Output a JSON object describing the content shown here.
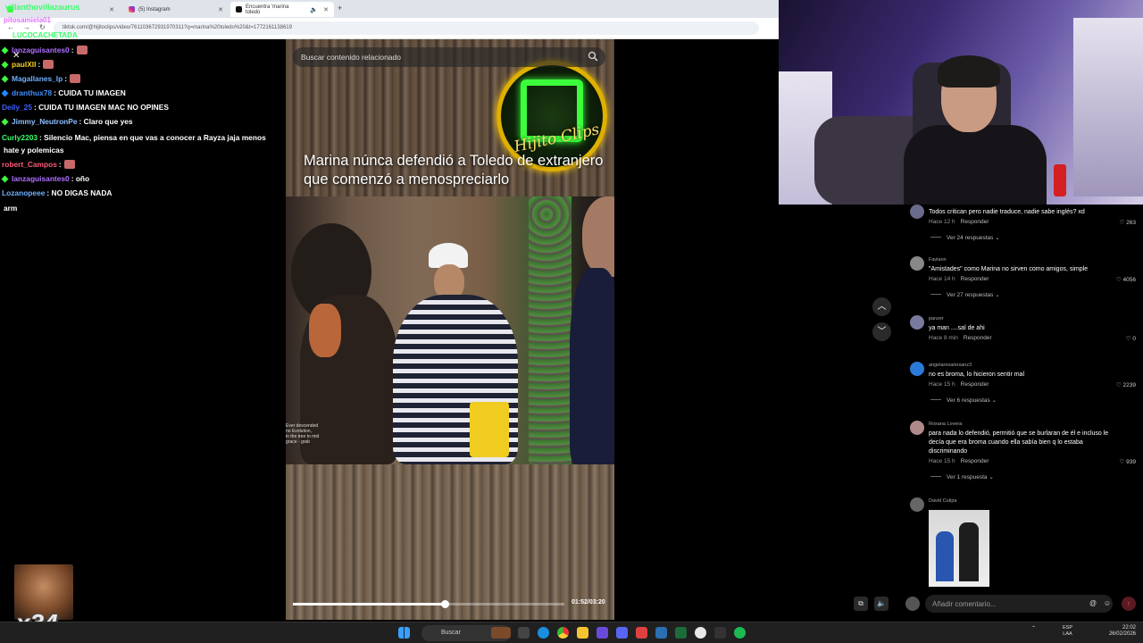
{
  "browser": {
    "tabs": [
      {
        "label": "Instagram_tab_1",
        "text": "(5) Instagram"
      },
      {
        "text": "Encuentra 'marina toledo"
      }
    ],
    "first_tab_text": "",
    "url": "tiktok.com/@hijitoclips/video/761103672931970311?q=marina%20toledo%20&t=1772161138619"
  },
  "overlay_names": [
    {
      "text": "villanthovillazaurus",
      "color": "#3cff6e"
    },
    {
      "text": "pitosamiela01",
      "color": "#e070ff"
    },
    {
      "text": "LUCOCACHETADA",
      "color": "#3cff6e"
    }
  ],
  "chat": [
    {
      "user": "lanzaguisantes0",
      "user_color": "#b070ff",
      "text": ":",
      "gem": "#3cff3c",
      "emote": true
    },
    {
      "user": "paulXII",
      "user_color": "#f5d020",
      "text": ":",
      "gem": "#3cff3c",
      "emote": true
    },
    {
      "user": "Magallanes_lp",
      "user_color": "#6db0ff",
      "text": ":",
      "gem": "#3cff3c",
      "emote": true
    },
    {
      "user": "dranthux78",
      "user_color": "#4090ff",
      "text": ": CUIDA TU IMAGEN",
      "gem": "#1e88ff",
      "emote": false
    },
    {
      "user": "Deily_25",
      "user_color": "#4060ff",
      "text": ": CUIDA TU IMAGEN MAC NO OPINES",
      "gem": "",
      "emote": false
    },
    {
      "user": "Jimmy_NeutronPe",
      "user_color": "#8ec0ff",
      "text": ": Claro que yes",
      "gem": "#3cff3c",
      "emote": false
    },
    {
      "user": "Curly2203",
      "user_color": "#3cff6e",
      "text": ": Silencio Mac, piensa en que vas a conocer a Rayza jaja menos",
      "gem": "",
      "emote": false
    },
    {
      "user": "",
      "user_color": "#fff",
      "text": "hate y polemicas",
      "gem": "",
      "emote": false
    },
    {
      "user": "robert_Campos",
      "user_color": "#ff5a7a",
      "text": ":",
      "gem": "",
      "emote": true
    },
    {
      "user": "lanzaguisantes0",
      "user_color": "#b070ff",
      "text": ": oño",
      "gem": "#3cff3c",
      "emote": false
    },
    {
      "user": "Lozanopeee",
      "user_color": "#6db0ff",
      "text": ": NO DIGAS NADA",
      "gem": "",
      "emote": false
    },
    {
      "user": "",
      "user_color": "#fff",
      "text": "arm",
      "gem": "",
      "emote": false
    }
  ],
  "video": {
    "search_placeholder": "Buscar contenido relacionado",
    "logo_text": "Hijito Clips",
    "caption": "Marina núnca defendió a Toledo de extranjero que comenzó a menospreciarlo",
    "subtitle_text": "Ever descended\nno Evolution,\nin the tree to mid\ngrace - grab",
    "time": "01:52/03:20",
    "progress": 0.56
  },
  "comments": [
    {
      "user": "",
      "text": "Todos critican pero nadie traduce, nadie sabe inglés? xd",
      "age": "Hace 12 h",
      "reply": "Responder",
      "likes": "263",
      "replies": "Ver 24 respuestas",
      "avatar": "#6a6a8a"
    },
    {
      "user": "Favlann",
      "text": "\"Amistades\" como Marina no sirven como amigos, simple",
      "age": "Hace 14 h",
      "reply": "Responder",
      "likes": "4056",
      "replies": "Ver 27 respuestas",
      "avatar": "#888"
    },
    {
      "user": "panzer",
      "text": "ya man ....sal de ahi",
      "age": "Hace 8 min",
      "reply": "Responder",
      "likes": "0",
      "replies": "",
      "avatar": "#7a7aa0"
    },
    {
      "user": "angelarosariosanz3",
      "text": "no es broma, lo hicieron sentir mal",
      "age": "Hace 15 h",
      "reply": "Responder",
      "likes": "2239",
      "replies": "Ver 6 respuestas",
      "avatar": "#2a7ad8"
    },
    {
      "user": "Roxana Lovera",
      "text": "para nada lo defendió, permitió que se burlaran de él e incluso le decía que era broma cuando ella sabía bien q lo estaba discriminando",
      "age": "Hace 15 h",
      "reply": "Responder",
      "likes": "939",
      "replies": "Ver 1 respuesta",
      "avatar": "#b08a8a"
    },
    {
      "user": "David Cutipa",
      "text": "",
      "age": "",
      "reply": "",
      "likes": "",
      "replies": "",
      "avatar": "#666"
    }
  ],
  "comment_bar": {
    "placeholder": "Añadir comentario..."
  },
  "emote_overlay": {
    "count": "x34"
  },
  "taskbar": {
    "search": "Buscar",
    "lang": "ESP\nLAA",
    "time": "22:02",
    "date": "26/02/2026"
  },
  "icons": {
    "search": "search-icon",
    "up": "chevron-up-icon",
    "down": "chevron-down-icon",
    "heart": "heart-icon",
    "windows": "windows-icon"
  }
}
